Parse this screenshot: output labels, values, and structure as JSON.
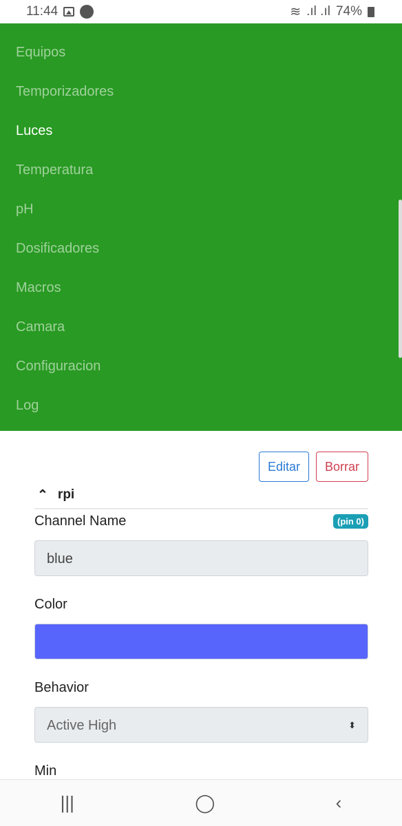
{
  "status_bar": {
    "time": "11:44",
    "battery": "74%"
  },
  "nav": {
    "items": [
      {
        "label": "Equipos",
        "active": false
      },
      {
        "label": "Temporizadores",
        "active": false
      },
      {
        "label": "Luces",
        "active": true
      },
      {
        "label": "Temperatura",
        "active": false
      },
      {
        "label": "pH",
        "active": false
      },
      {
        "label": "Dosificadores",
        "active": false
      },
      {
        "label": "Macros",
        "active": false
      },
      {
        "label": "Camara",
        "active": false
      },
      {
        "label": "Configuracion",
        "active": false
      },
      {
        "label": "Log",
        "active": false
      }
    ],
    "color": "#299a23"
  },
  "actions": {
    "edit": "Editar",
    "delete": "Borrar"
  },
  "section": {
    "title": "rpi"
  },
  "form": {
    "channel_name_label": "Channel Name",
    "pin_badge": "(pin 0)",
    "channel_name_value": "blue",
    "color_label": "Color",
    "color_value": "#5865fc",
    "behavior_label": "Behavior",
    "behavior_value": "Active High",
    "min_label": "Min"
  }
}
